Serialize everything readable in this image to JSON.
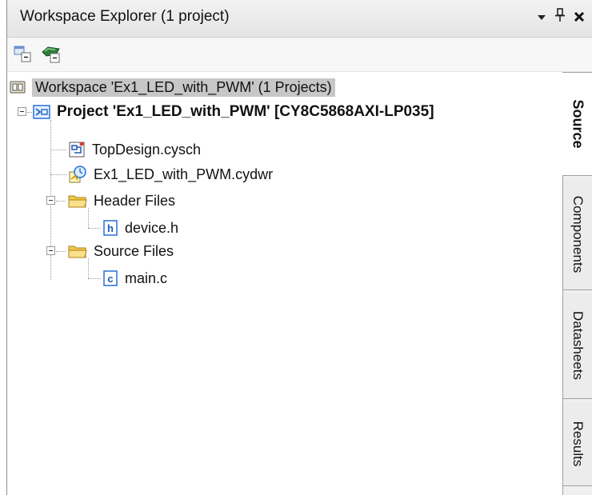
{
  "window": {
    "title": "Workspace Explorer (1 project)",
    "pin_glyph": "¶",
    "dropdown_glyph": "▾",
    "close_glyph": "✕"
  },
  "toolbar": {
    "buttons": [
      {
        "icon": "collapse-all-icon"
      },
      {
        "icon": "build-settings-icon"
      }
    ]
  },
  "tree": {
    "workspace": "Workspace 'Ex1_LED_with_PWM' (1 Projects)",
    "project": "Project 'Ex1_LED_with_PWM' [CY8C5868AXI-LP035]",
    "items": [
      {
        "label": "TopDesign.cysch",
        "icon": "schematic-icon"
      },
      {
        "label": "Ex1_LED_with_PWM.cydwr",
        "icon": "design-wide-resources-icon"
      },
      {
        "label": "Header Files",
        "icon": "folder-icon"
      },
      {
        "label": "device.h",
        "icon": "header-file-icon",
        "badge": "h"
      },
      {
        "label": "Source Files",
        "icon": "folder-icon"
      },
      {
        "label": "main.c",
        "icon": "c-file-icon",
        "badge": "c"
      }
    ]
  },
  "tabs": [
    {
      "label": "Source",
      "active": true
    },
    {
      "label": "Components",
      "active": false
    },
    {
      "label": "Datasheets",
      "active": false
    },
    {
      "label": "Results",
      "active": false
    }
  ],
  "colors": {
    "project_icon_blue": "#2a6fd6",
    "folder_yellow": "#f3c948",
    "selection_gray": "#c7c7c7"
  }
}
